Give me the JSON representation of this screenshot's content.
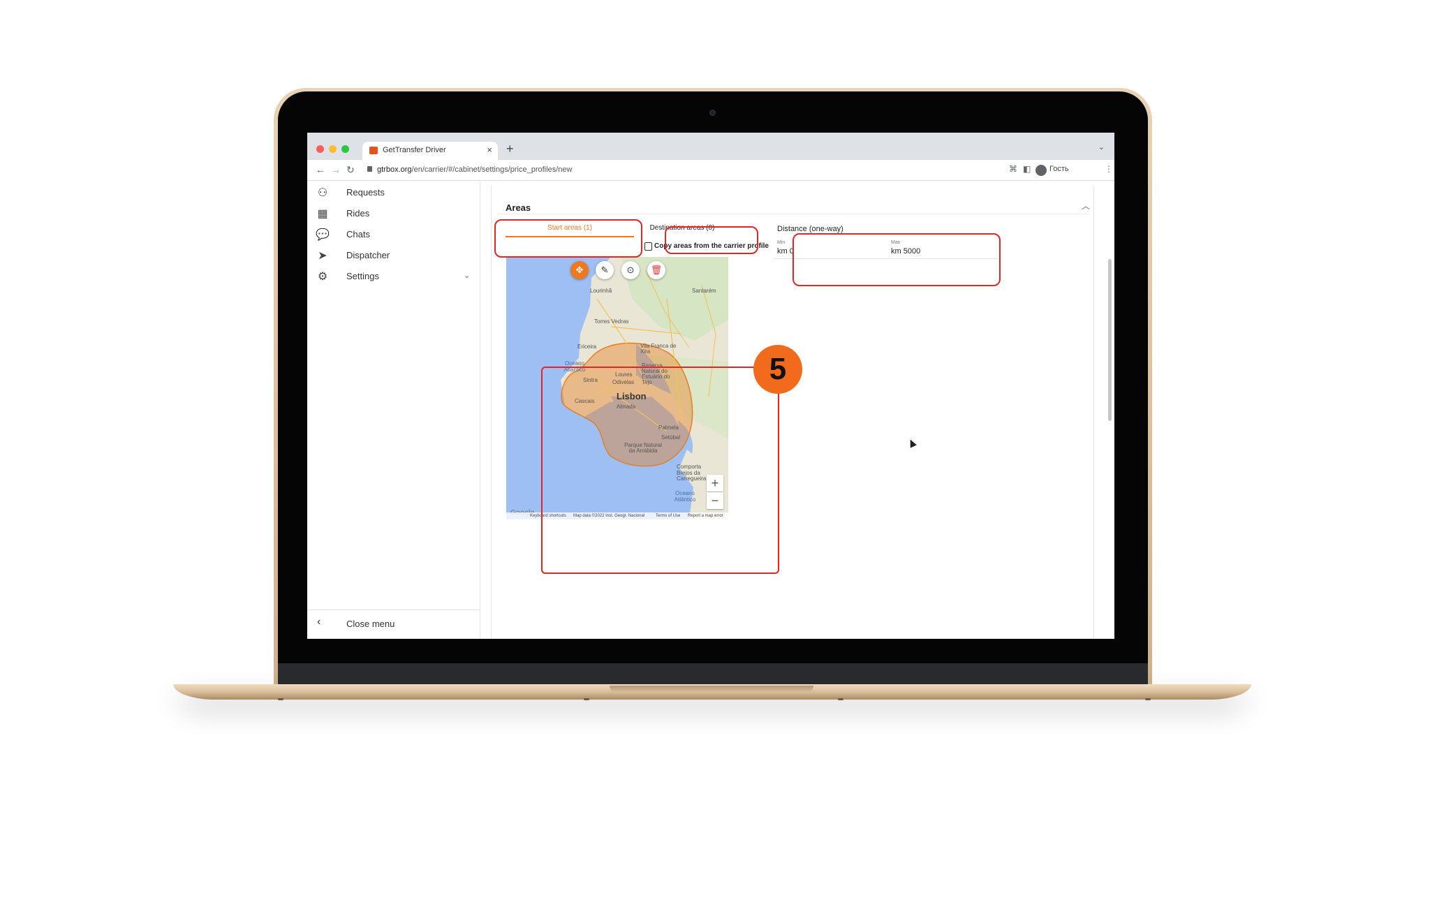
{
  "browser": {
    "tab_title": "GetTransfer Driver",
    "tab_close": "×",
    "new_tab": "+",
    "url_host": "gtrbox.org",
    "url_path": "/en/carrier/#/cabinet/settings/price_profiles/new",
    "guest_label": "Гость"
  },
  "sidebar": {
    "items": [
      {
        "label": "Requests",
        "icon": "requests-icon"
      },
      {
        "label": "Rides",
        "icon": "calendar-icon"
      },
      {
        "label": "Chats",
        "icon": "chat-icon"
      },
      {
        "label": "Dispatcher",
        "icon": "send-icon"
      },
      {
        "label": "Settings",
        "icon": "gear-icon"
      }
    ],
    "close_menu": "Close menu"
  },
  "areas": {
    "title": "Areas",
    "start_tab": "Start areas (1)",
    "dest_tab": "Destination areas (0)",
    "copy_label": "Copy areas from the carrier profile"
  },
  "distance": {
    "title": "Distance (one-way)",
    "min_label": "Min",
    "max_label": "Max",
    "min_value": "km 0",
    "max_value": "km 5000"
  },
  "map": {
    "labels": [
      "Lourinhã",
      "Santarém",
      "Torres Vedras",
      "Ericeira",
      "Vila Franca de Xira",
      "Reserva Natural do Estuário do Tejo",
      "Sintra",
      "Loures",
      "Odivelas",
      "Cascais",
      "Almada",
      "Palmela",
      "Setúbal",
      "Parque Natural da Arrábida",
      "Comporta",
      "Brejos da Carregueira"
    ],
    "city": "Lisbon",
    "ocean_1": "Oceano Atlântico",
    "ocean_2": "Oceano Atlântico",
    "zoom_in": "+",
    "zoom_out": "−",
    "footer": [
      "Keyboard shortcuts",
      "Map data ©2022 Inst. Geogr. Nacional",
      "Terms of Use",
      "Report a map error"
    ],
    "google": "Google"
  },
  "annotation": {
    "step_number": "5",
    "highlight_color": "#e52424",
    "badge_color": "#f26a1b"
  },
  "colors": {
    "accent": "#f07820"
  }
}
